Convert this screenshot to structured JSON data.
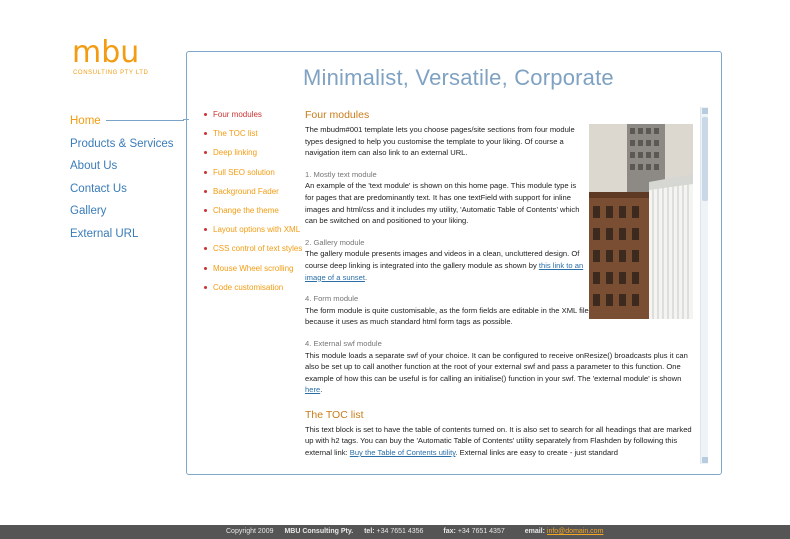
{
  "logo": {
    "mark": "mbu",
    "subtitle": "CONSULTING PTY LTD"
  },
  "nav": {
    "items": [
      {
        "label": "Home",
        "active": true
      },
      {
        "label": "Products & Services"
      },
      {
        "label": "About Us"
      },
      {
        "label": "Contact Us"
      },
      {
        "label": "Gallery"
      },
      {
        "label": "External URL"
      }
    ]
  },
  "page": {
    "title": "Minimalist, Versatile, Corporate"
  },
  "toc": {
    "items": [
      {
        "label": "Four modules",
        "active": true
      },
      {
        "label": "The TOC list"
      },
      {
        "label": "Deep linking"
      },
      {
        "label": "Full SEO solution"
      },
      {
        "label": "Background Fader"
      },
      {
        "label": "Change the theme"
      },
      {
        "label": "Layout options with XML"
      },
      {
        "label": "CSS control of text styles"
      },
      {
        "label": "Mouse Wheel scrolling"
      },
      {
        "label": "Code customisation"
      }
    ]
  },
  "content": {
    "h_four_modules": "Four modules",
    "intro": "The mbudm#001 template lets you choose pages/site sections from four module types designed to help you customise the template to your liking. Of course a navigation item can also link to an external URL.",
    "m1_title": "1. Mostly text module",
    "m1_text": "An example of the 'text module' is shown on this home page. This module type is for pages that are predominantly text. It has one textField with support for inline images and html/css and it includes my utility, 'Automatic Table of Contents' which can be switched on and positioned to your liking.",
    "m2_title": "2. Gallery module",
    "m2_text": "The gallery module presents images and videos in a clean, uncluttered design. Of course deep linking is integrated into the gallery module as shown by",
    "m2_link": "this link to an image of a sunset",
    "m2_end": ".",
    "m4_title": "4. Form module",
    "m4_text": "The form module is quite customisable, as the form fields are editable in the XML file. The XMl is also very easy, because it uses as much standard html form tags as possible.",
    "m5_title": "4. External swf module",
    "m5_text": "This module loads a separate swf of your choice. It can be configured to receive onResize() broadcasts plus it can also be set up to call another function at the root of your external swf and pass a parameter to this function. One example of how this can be useful is for calling an initialise() function in your swf. The 'external module' is shown",
    "m5_link": "here",
    "m5_end": ".",
    "h_toc": "The TOC list",
    "toc_text": "This text block is set to have the table of contents turned on. It is also set to search for all headings that are marked up with h2 tags. You can buy the 'Automatic Table of Contents' utility separately from Flashden by following this external link:",
    "toc_link": "Buy the Table of Contents utility",
    "toc_end": ". External links are easy to create - just standard"
  },
  "footer": {
    "copyright": "Copyright 2009",
    "company": "MBU Consulting Pty.",
    "tel_label": "tel:",
    "tel": "+34 7651 4356",
    "fax_label": "fax:",
    "fax": "+34 7651 4357",
    "email_label": "email:",
    "email": "info@domain.com"
  },
  "colors": {
    "accent": "#f39c12",
    "link": "#3a7cb8",
    "title": "#7fa2c2",
    "active_toc": "#cc3333",
    "footer_bg": "#555555"
  }
}
